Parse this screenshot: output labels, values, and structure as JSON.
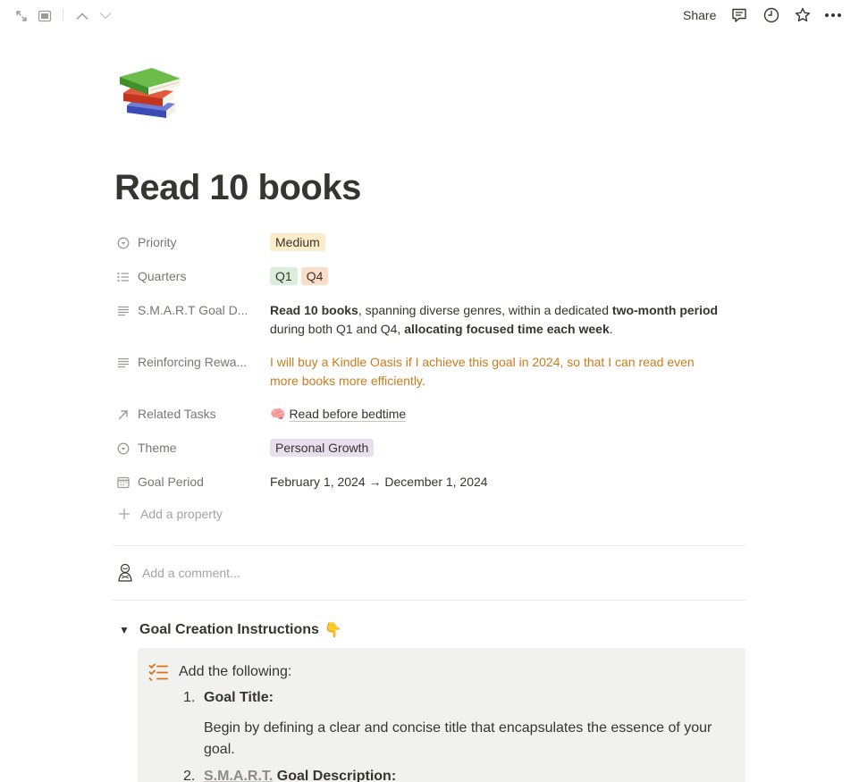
{
  "topbar": {
    "share_label": "Share",
    "icons": [
      "expand-icon",
      "sidebar-panel-icon",
      "chevron-up-icon",
      "chevron-down-icon",
      "comment-icon",
      "clock-icon",
      "star-icon",
      "more-icon"
    ]
  },
  "page": {
    "icon": "books-emoji",
    "title": "Read 10 books"
  },
  "properties": {
    "priority": {
      "name": "Priority",
      "value": "Medium",
      "color": "#fdecc8"
    },
    "quarters": {
      "name": "Quarters",
      "values": [
        "Q1",
        "Q4"
      ],
      "colors": [
        "#dbeddb",
        "#fadec9"
      ]
    },
    "smart_goal": {
      "name": "S.M.A.R.T Goal D...",
      "parts": [
        {
          "t": "Read 10 books",
          "b": true
        },
        {
          "t": ", spanning diverse genres, within a dedicated ",
          "b": false
        },
        {
          "t": "two-month period",
          "b": true
        },
        {
          "t": " during both Q1 and Q4, ",
          "b": false
        },
        {
          "t": "allocating focused time each week",
          "b": true
        },
        {
          "t": ".",
          "b": false
        }
      ]
    },
    "reward": {
      "name": "Reinforcing Rewa...",
      "value": "I will buy a Kindle Oasis if I achieve this goal in 2024, so that I can read even more books more efficiently."
    },
    "related_tasks": {
      "name": "Related Tasks",
      "value": "Read before bedtime",
      "emoji": "🧠"
    },
    "theme": {
      "name": "Theme",
      "value": "Personal Growth",
      "color": "#e8deee"
    },
    "goal_period": {
      "name": "Goal Period",
      "value": "February 1, 2024 → December 1, 2024"
    },
    "add_property": "Add a property"
  },
  "comment": {
    "placeholder": "Add a comment..."
  },
  "toggle": {
    "title": "Goal Creation Instructions",
    "emoji": "👇"
  },
  "callout": {
    "heading": "Add the following:",
    "items": [
      {
        "num": "1.",
        "title": "Goal Title:",
        "body": "Begin by defining a clear and concise title that encapsulates the essence of your goal."
      },
      {
        "num": "2.",
        "title_muted": "S.M.A.R.T.",
        "title": " Goal Description:"
      }
    ]
  }
}
